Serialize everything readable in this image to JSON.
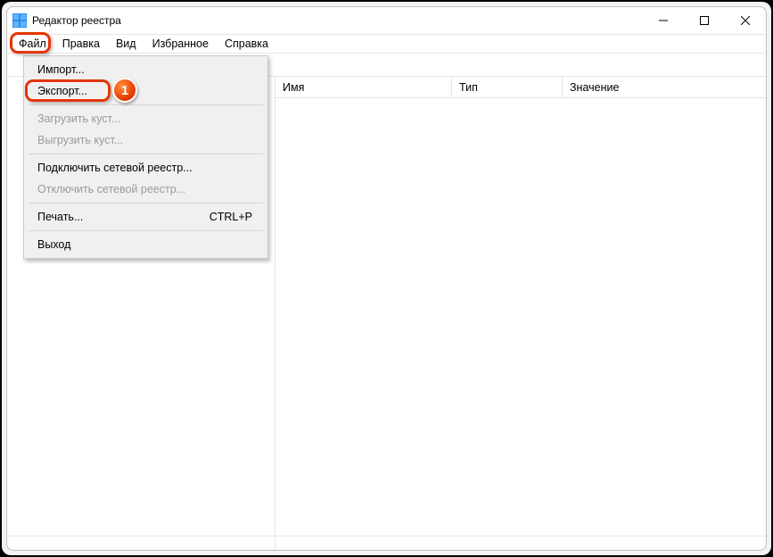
{
  "window": {
    "title": "Редактор реестра"
  },
  "menubar": {
    "items": [
      "Файл",
      "Правка",
      "Вид",
      "Избранное",
      "Справка"
    ]
  },
  "addressbar": {
    "value": ""
  },
  "columns": {
    "name": "Имя",
    "type": "Тип",
    "value": "Значение"
  },
  "file_menu": {
    "import": "Импорт...",
    "export": "Экспорт...",
    "load_hive": "Загрузить куст...",
    "unload_hive": "Выгрузить куст...",
    "connect_net": "Подключить сетевой реестр...",
    "disconnect_net": "Отключить сетевой реестр...",
    "print": "Печать...",
    "print_shortcut": "CTRL+P",
    "exit": "Выход"
  },
  "annotation": {
    "badge": "1"
  }
}
